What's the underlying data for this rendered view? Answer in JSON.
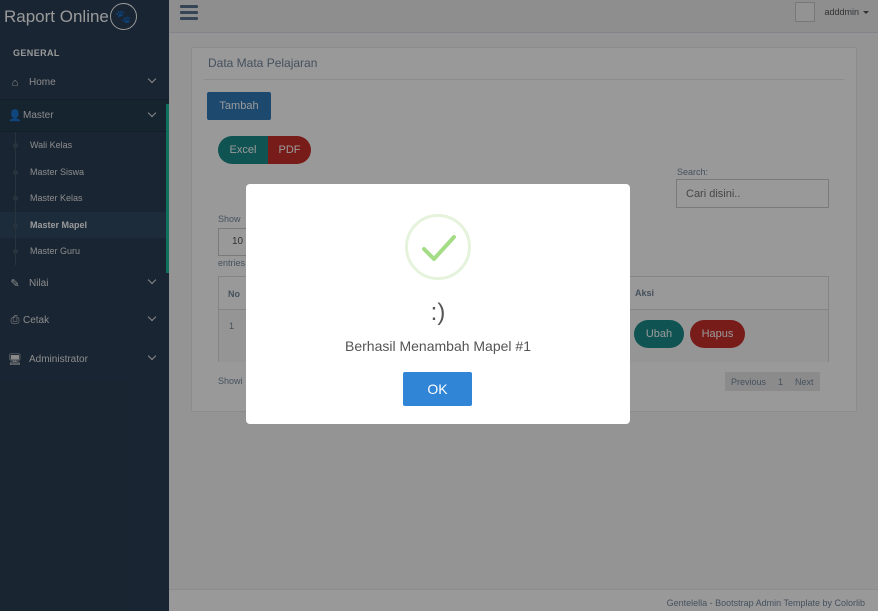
{
  "brand": {
    "name": "Raport Online",
    "icon": "paw-icon"
  },
  "sidebar": {
    "section": "GENERAL",
    "items": [
      {
        "label": "Home",
        "icon": "home-icon"
      },
      {
        "label": "Master",
        "icon": "user-icon"
      },
      {
        "label": "Nilai",
        "icon": "edit-icon"
      },
      {
        "label": "Cetak",
        "icon": "print-icon"
      },
      {
        "label": "Administrator",
        "icon": "desktop-icon"
      }
    ],
    "master_sub": [
      "Wali Kelas",
      "Master Siswa",
      "Master Kelas",
      "Master Mapel",
      "Master Guru"
    ]
  },
  "topbar": {
    "username": "adddmin"
  },
  "panel": {
    "title": "Data Mata Pelajaran",
    "add_button": "Tambah",
    "excel_button": "Excel",
    "pdf_button": "PDF",
    "search_label": "Search:",
    "search_placeholder": "Cari disini..",
    "show_label": "Show",
    "length_value": "10",
    "entries_label": "entries",
    "columns": {
      "no": "No",
      "aksi": "Aksi"
    },
    "rows": [
      {
        "no": "1",
        "edit": "Ubah",
        "delete": "Hapus"
      }
    ],
    "showing": "Showi",
    "pager": {
      "prev": "Previous",
      "page": "1",
      "next": "Next"
    }
  },
  "footer": {
    "text": "Gentelella - Bootstrap Admin Template by Colorlib"
  },
  "modal": {
    "title": ":)",
    "message": "Berhasil Menambah Mapel #1",
    "ok": "OK",
    "icon": "success-check-icon"
  },
  "colors": {
    "sidebar": "#2a3f54",
    "accent": "#1abb9c",
    "primary": "#3085d6",
    "success": "#a5dc86"
  }
}
